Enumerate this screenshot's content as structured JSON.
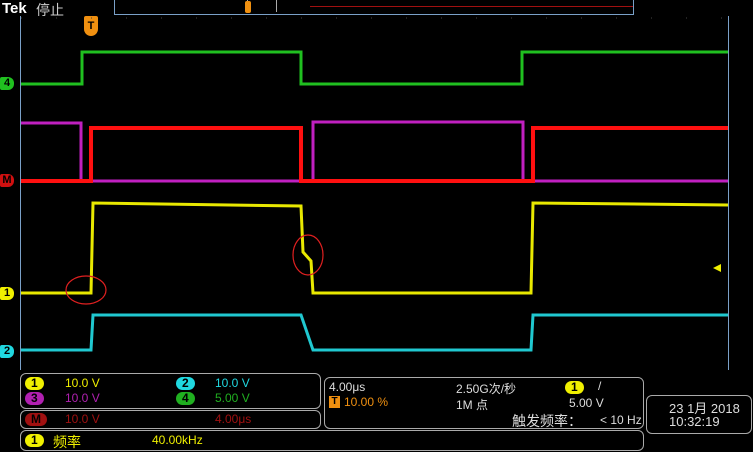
{
  "header": {
    "brand": "Tek",
    "status": "停止",
    "trigger_marker": "T"
  },
  "markers": {
    "ch4": "4",
    "math": "M",
    "ch1": "1",
    "ch2": "2"
  },
  "channels": [
    {
      "id": "1",
      "scale": "10.0 V",
      "color": "#f0f000"
    },
    {
      "id": "2",
      "scale": "10.0 V",
      "color": "#20d8e0"
    },
    {
      "id": "3",
      "scale": "10.0 V",
      "color": "#c020c0"
    },
    {
      "id": "4",
      "scale": "5.00 V",
      "color": "#20c020"
    }
  ],
  "math": {
    "id": "M",
    "scale": "10.0 V",
    "time": "4.00μs",
    "color": "#c01010"
  },
  "measurement": {
    "channel": "1",
    "label": "频率",
    "value": "40.00kHz"
  },
  "horizontal": {
    "scale": "4.00μs",
    "trigger_pos_icon": "T",
    "trigger_pos": "10.00 %",
    "sample_rate": "2.50G次/秒",
    "record_length": "1M 点"
  },
  "trigger": {
    "channel": "1",
    "slope": "/",
    "level": "5.00 V",
    "freq_label": "触发频率：",
    "freq": "< 10 Hz"
  },
  "datetime": {
    "date": "23 1月 2018",
    "time": "10:32:19"
  }
}
